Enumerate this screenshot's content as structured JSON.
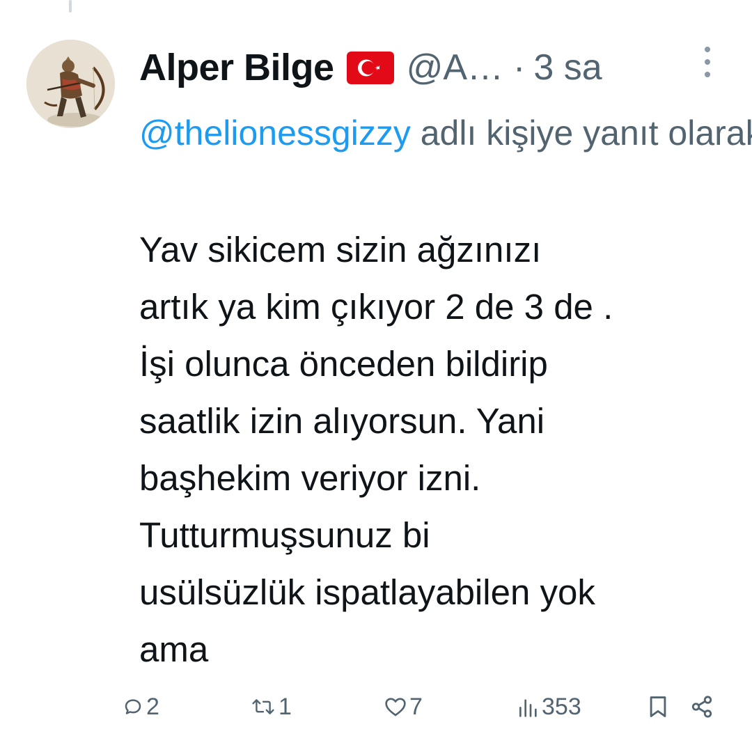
{
  "tweet": {
    "author": {
      "display_name": "Alper Bilge",
      "flag_icon": "turkey-flag-icon",
      "handle": "@A…",
      "avatar_icon": "archer-avatar"
    },
    "separator": "·",
    "timestamp": "3 sa",
    "reply_context": {
      "mention": "@thelionessgizzy",
      "suffix": " adlı kişiye yanıt olarak"
    },
    "text_lines": [
      "Yav sikicem sizin ağzınızı",
      "artık ya kim çıkıyor 2 de 3 de .",
      "İşi olunca önceden bildirip",
      "saatlik izin alıyorsun. Yani",
      "başhekim veriyor izni.",
      "Tutturmuşsunuz bi",
      "usülsüzlük ispatlayabilen yok",
      "ama"
    ],
    "actions": {
      "replies": "2",
      "retweets": "1",
      "likes": "7",
      "views": "353"
    }
  },
  "colors": {
    "text_primary": "#0f1419",
    "text_secondary": "#536471",
    "link": "#1d9bf0",
    "icon": "#536471",
    "thread_line": "#cfd9de"
  }
}
